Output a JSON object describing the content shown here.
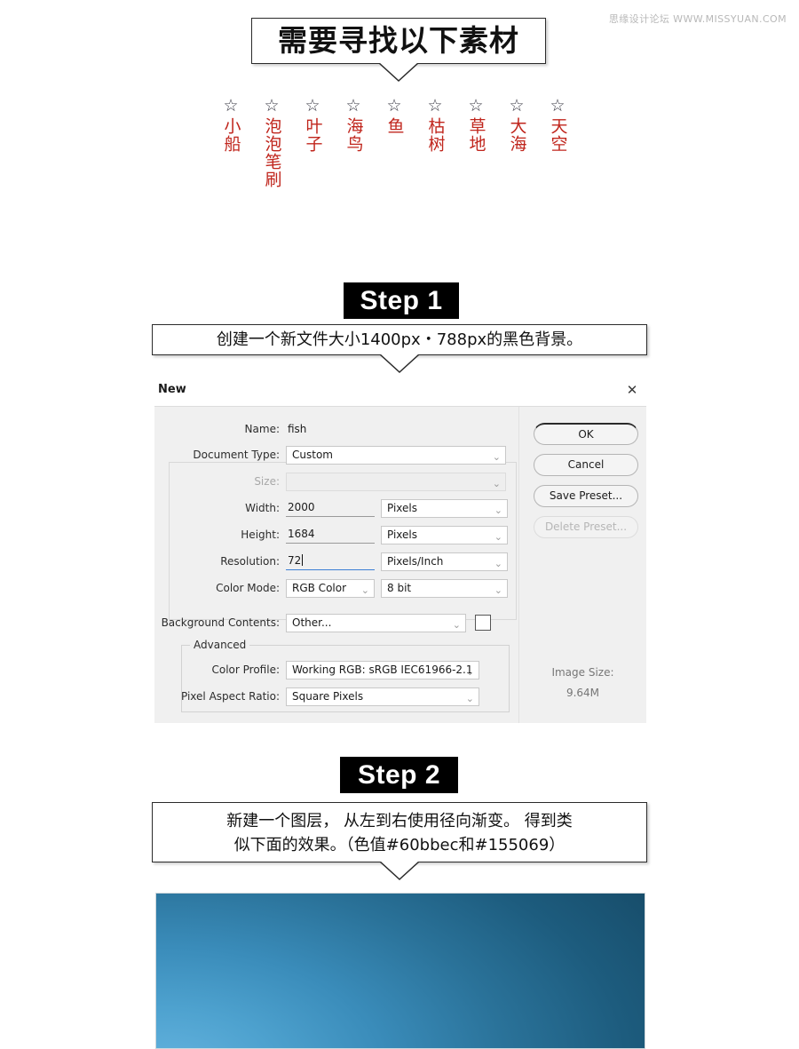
{
  "watermark": "思缘设计论坛  WWW.MISSYUAN.COM",
  "header": {
    "title": "需要寻找以下素材"
  },
  "assets": {
    "star_icon": "☆",
    "items": [
      {
        "label": "小船"
      },
      {
        "label": "泡泡笔刷"
      },
      {
        "label": "叶子"
      },
      {
        "label": "海鸟"
      },
      {
        "label": "鱼"
      },
      {
        "label": "枯树"
      },
      {
        "label": "草地"
      },
      {
        "label": "大海"
      },
      {
        "label": "天空"
      }
    ]
  },
  "step1": {
    "chip": "Step 1",
    "caption": "创建一个新文件大小1400px・788px的黑色背景。"
  },
  "step2": {
    "chip": "Step 2",
    "caption_line1": "新建一个图层， 从左到右使用径向渐变。 得到类",
    "caption_line2": "似下面的效果。（色值#60bbec和#155069）",
    "color_1": "#60bbec",
    "color_2": "#155069"
  },
  "dialog": {
    "title": "New",
    "close_icon": "✕",
    "chevron_icon": "⌄",
    "fields": {
      "name_label": "Name:",
      "name_value": "fish",
      "document_type_label": "Document Type:",
      "document_type_value": "Custom",
      "size_label": "Size:",
      "size_value": "",
      "width_label": "Width:",
      "width_value": "2000",
      "width_unit": "Pixels",
      "height_label": "Height:",
      "height_value": "1684",
      "height_unit": "Pixels",
      "resolution_label": "Resolution:",
      "resolution_value": "72",
      "resolution_unit": "Pixels/Inch",
      "color_mode_label": "Color Mode:",
      "color_mode_value": "RGB Color",
      "bit_depth_value": "8 bit",
      "background_contents_label": "Background Contents:",
      "background_contents_value": "Other...",
      "background_swatch_color": "#ffffff",
      "advanced_label": "Advanced",
      "color_profile_label": "Color Profile:",
      "color_profile_value": "Working RGB:  sRGB IEC61966-2.1",
      "pixel_aspect_label": "Pixel Aspect Ratio:",
      "pixel_aspect_value": "Square Pixels"
    },
    "buttons": {
      "ok": "OK",
      "cancel": "Cancel",
      "save_preset": "Save Preset...",
      "delete_preset": "Delete Preset..."
    },
    "image_size_label": "Image Size:",
    "image_size_value": "9.64M"
  }
}
